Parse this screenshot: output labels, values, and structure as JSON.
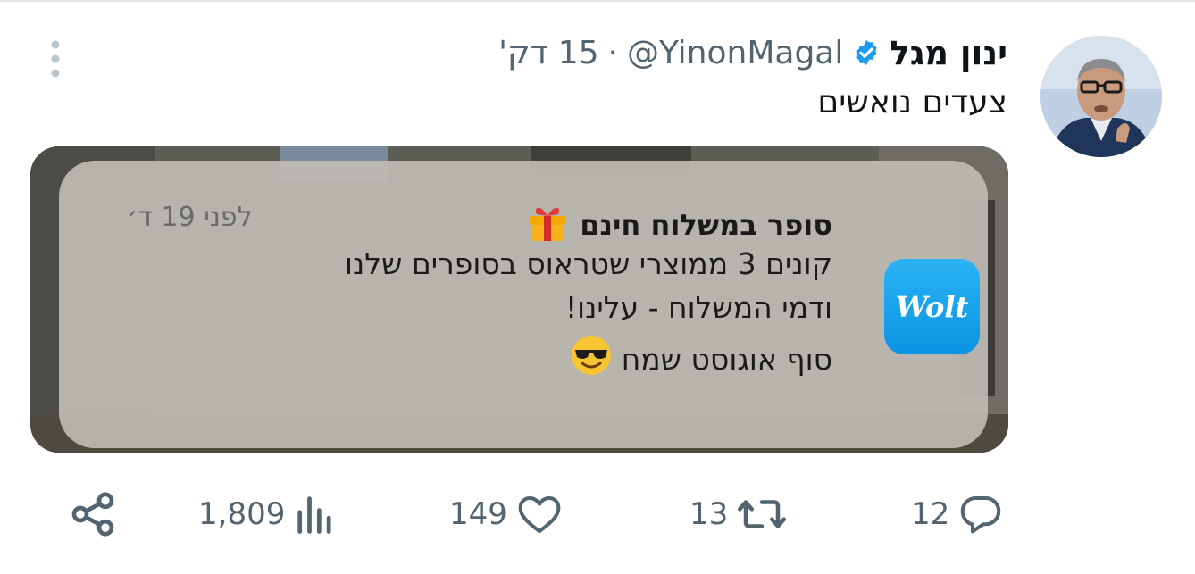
{
  "tweet": {
    "author_name": "ינון מגל",
    "handle": "@YinonMagal",
    "separator": "·",
    "time": "15 דק'",
    "text": "צעדים נואשים",
    "verified_color": "#1d9bf0"
  },
  "media": {
    "notification": {
      "app_name": "Wolt",
      "title": "סופר במשלוח חינם",
      "time": "לפני 19 ד׳",
      "lines": [
        "קונים 3 ממוצרי שטראוס בסופרים שלנו",
        "ודמי המשלוח - עלינו!",
        "סוף אוגוסט שמח"
      ],
      "icons": [
        "gift-emoji-icon",
        "sunglasses-emoji-icon"
      ]
    }
  },
  "actions": {
    "replies": "12",
    "retweets": "13",
    "likes": "149",
    "views": "1,809"
  },
  "colors": {
    "text_secondary": "#536471",
    "wolt_blue": "#1aa3ea"
  }
}
